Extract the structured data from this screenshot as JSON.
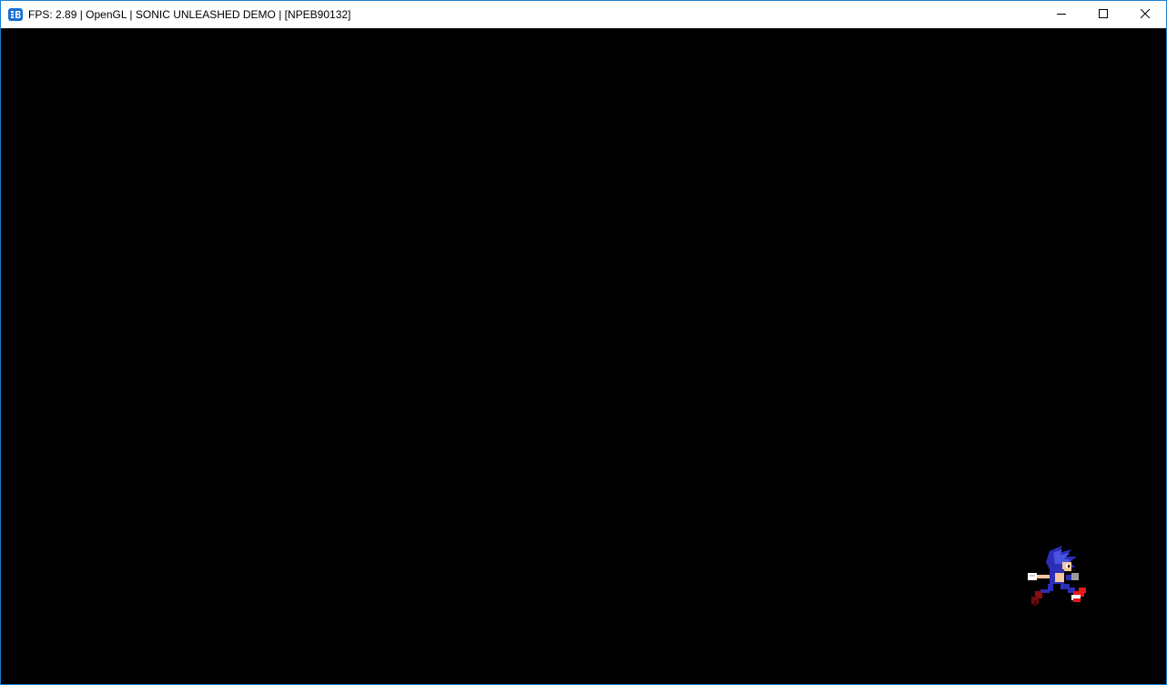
{
  "window": {
    "title": "FPS: 2.89 | OpenGL | SONIC UNLEASHED DEMO | [NPEB90132]",
    "app_icon": "rpcs3-icon",
    "accent_color": "#1a7fd4",
    "controls": {
      "minimize": "minimize-icon",
      "maximize": "maximize-icon",
      "close": "close-icon"
    }
  },
  "viewport": {
    "background": "#000000",
    "content": "loading-sprite-running-hedgehog"
  }
}
